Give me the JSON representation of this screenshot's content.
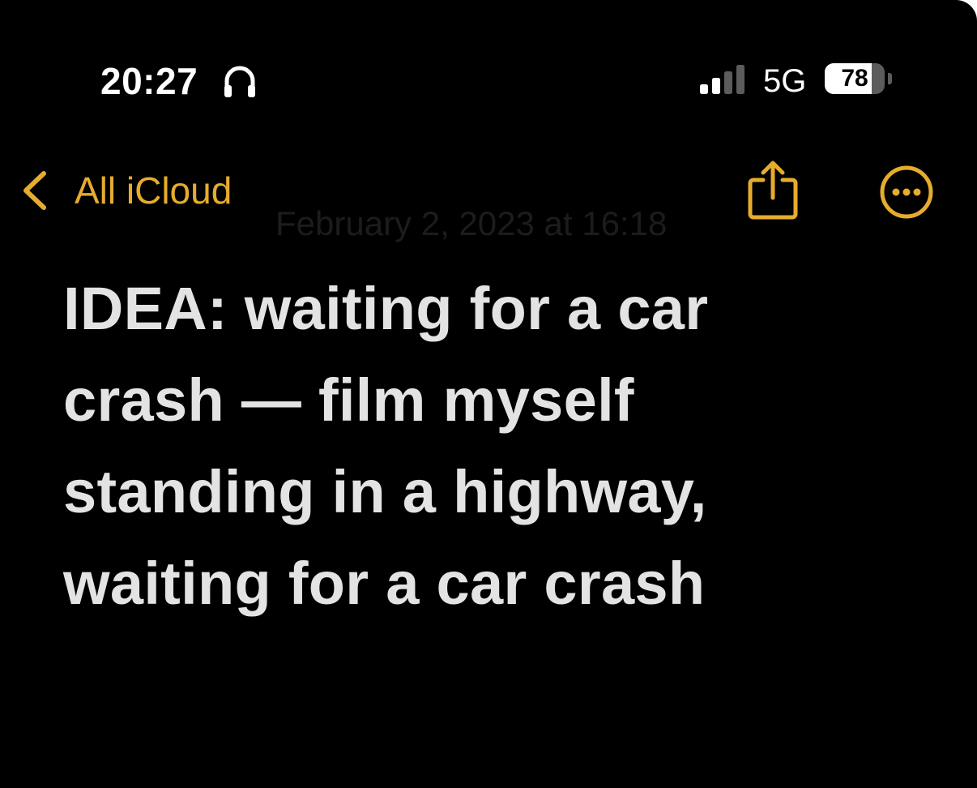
{
  "status_bar": {
    "time": "20:27",
    "network": "5G",
    "battery_level": "78",
    "battery_fraction": 0.78,
    "signal_bars_active": 2,
    "signal_bars_total": 4,
    "headphones_icon": "headphones-icon"
  },
  "nav": {
    "back_label": "All iCloud",
    "back_icon": "chevron-left-icon",
    "share_icon": "share-icon",
    "more_icon": "more-icon"
  },
  "note": {
    "date": "February 2, 2023 at 16:18",
    "title_lines": [
      "IDEA: waiting for a car",
      "crash — film myself",
      "standing in a highway,",
      "waiting for a car crash"
    ]
  },
  "colors": {
    "background": "#000000",
    "accent": "#e6ac2c",
    "text": "#e3e3e3",
    "status_text": "#ffffff",
    "date_text": "#1c1c1c"
  }
}
